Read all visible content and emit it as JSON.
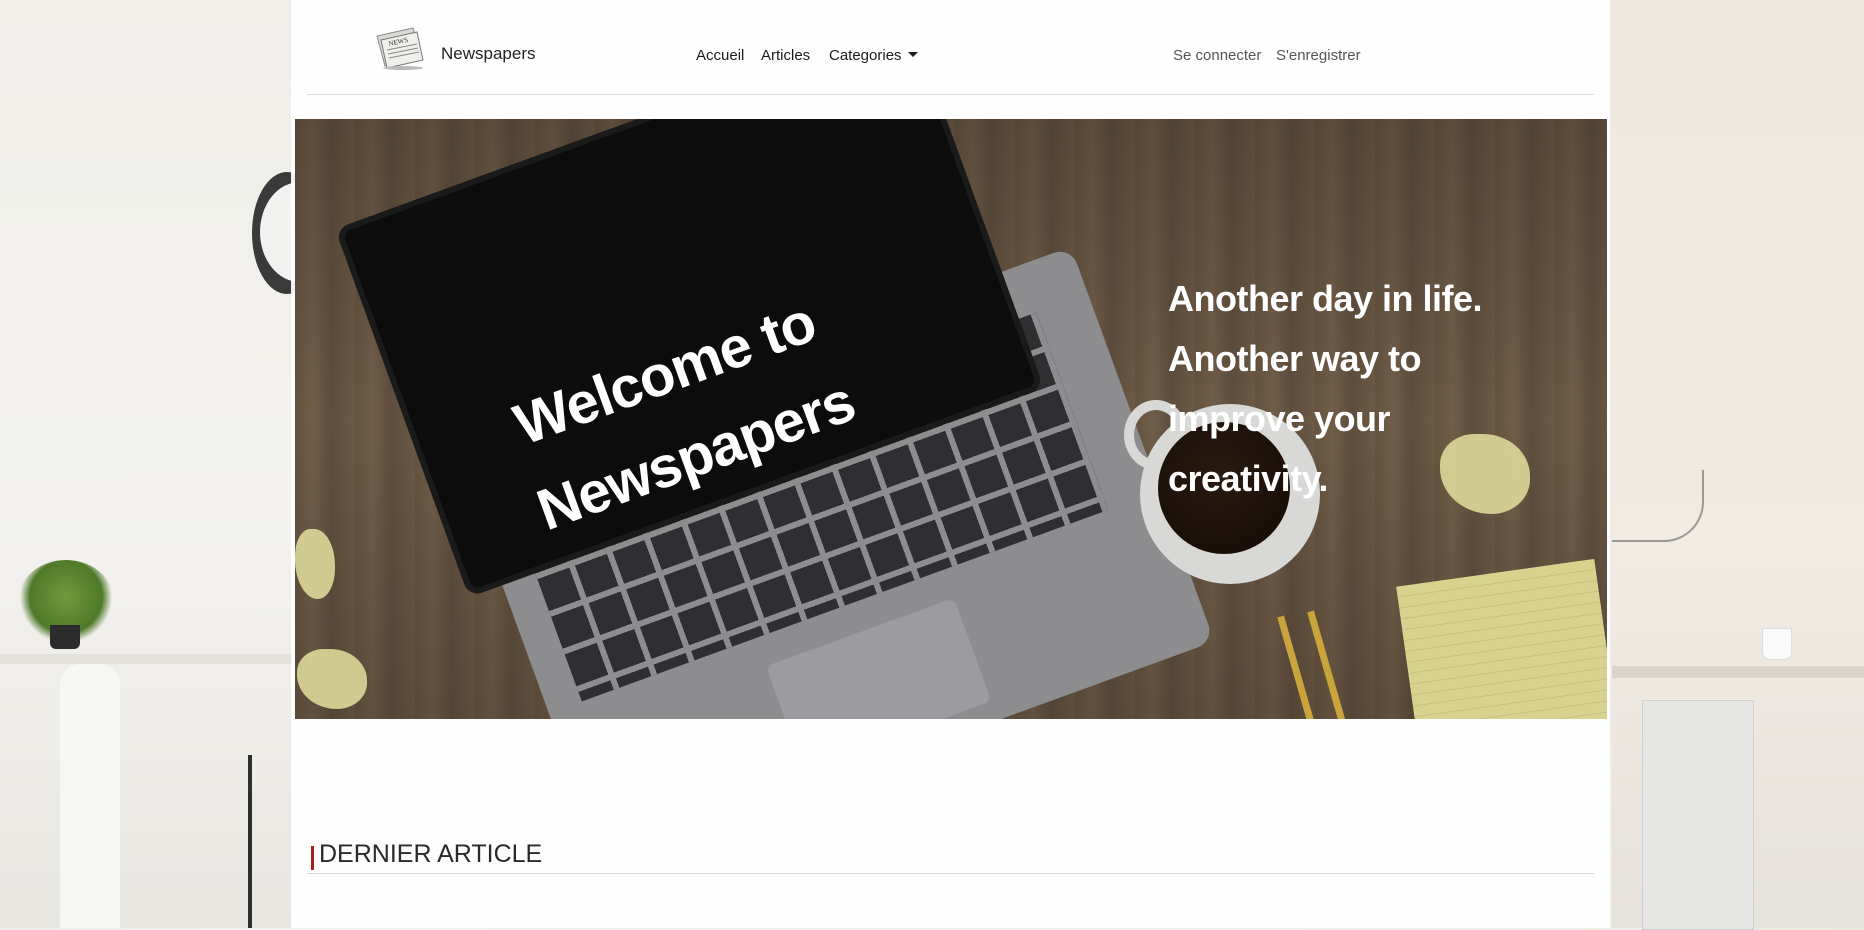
{
  "brand": {
    "name": "Newspapers",
    "logo_icon": "newspaper-icon",
    "logo_text": "NEWS"
  },
  "nav": {
    "items": [
      {
        "label": "Accueil"
      },
      {
        "label": "Articles"
      },
      {
        "label": "Categories"
      }
    ],
    "auth": {
      "login_label": "Se connecter",
      "register_label": "S'enregistrer"
    }
  },
  "hero": {
    "screen_line1": "Welcome to",
    "screen_line2": "Newspapers",
    "tagline_lines": [
      "Another day in life.",
      "Another way to",
      "improve your",
      "creativity."
    ]
  },
  "section": {
    "title": "DERNIER ARTICLE",
    "accent_color": "#a81f1f"
  }
}
